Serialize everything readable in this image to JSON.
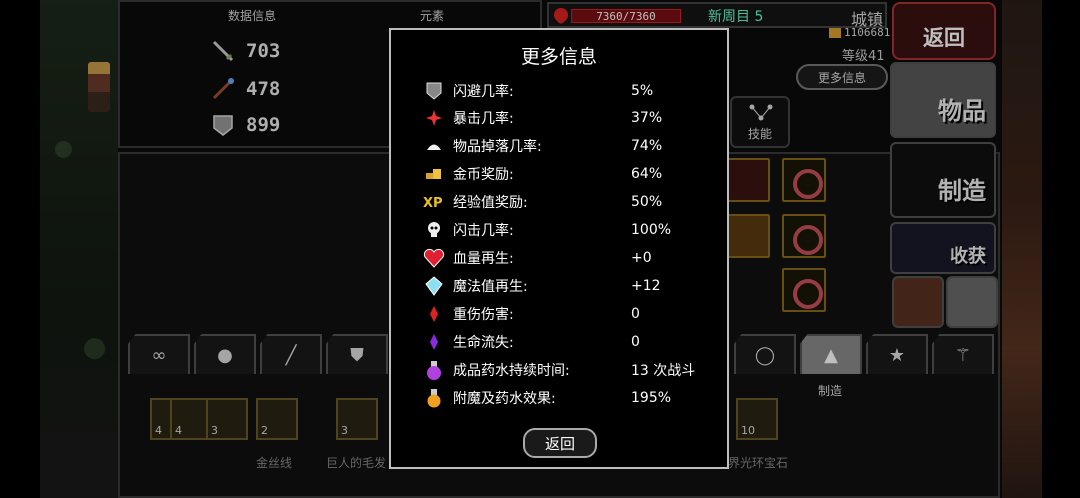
{
  "stats_panel": {
    "header_left": "数据信息",
    "header_right": "元素",
    "attack": "703",
    "magic": "478",
    "defense": "899"
  },
  "hud": {
    "hp": "7360/7360",
    "new_cycle": "新周目 5",
    "location": "城镇",
    "gold": "1106681",
    "level": "等级41",
    "more_info_label": "更多信息",
    "skills_label": "技能"
  },
  "side_menu": {
    "back": "返回",
    "items": "物品",
    "craft": "制造",
    "harvest": "收获"
  },
  "tabs": {
    "active_label": "制造",
    "icons": [
      "infinity",
      "bag",
      "sword",
      "shield",
      "ring",
      "craft",
      "star",
      "wand"
    ]
  },
  "inventory": {
    "slots": [
      {
        "count": "4"
      },
      {
        "count": "4"
      },
      {
        "count": "3"
      },
      {
        "count": "2"
      },
      {
        "count": "3"
      },
      {
        "count": "10"
      }
    ],
    "names": [
      "金丝线",
      "巨人的毛发",
      "界光环宝石"
    ]
  },
  "modal": {
    "title": "更多信息",
    "rows": [
      {
        "icon": "dodge-icon",
        "label": "闪避几率:",
        "value": "5%"
      },
      {
        "icon": "crit-icon",
        "label": "暴击几率:",
        "value": "37%"
      },
      {
        "icon": "drop-icon",
        "label": "物品掉落几率:",
        "value": "74%"
      },
      {
        "icon": "gold-icon",
        "label": "金币奖励:",
        "value": "64%"
      },
      {
        "icon": "xp-icon",
        "label": "经验值奖励:",
        "value": "50%"
      },
      {
        "icon": "skull-icon",
        "label": "闪击几率:",
        "value": "100%"
      },
      {
        "icon": "heart-icon",
        "label": "血量再生:",
        "value": "+0"
      },
      {
        "icon": "mana-crystal-icon",
        "label": "魔法值再生:",
        "value": "+12"
      },
      {
        "icon": "wound-icon",
        "label": "重伤伤害:",
        "value": "0"
      },
      {
        "icon": "life-drain-icon",
        "label": "生命流失:",
        "value": "0"
      },
      {
        "icon": "potion-icon",
        "label": "成品药水持续时间:",
        "value": "13 次战斗"
      },
      {
        "icon": "enchant-icon",
        "label": "附魔及药水效果:",
        "value": "195%"
      }
    ],
    "back_label": "返回"
  },
  "colors": {
    "modal_border": "#bdbdbd",
    "hp_red": "#7a0f12",
    "cycle_green": "#66ffcc"
  }
}
